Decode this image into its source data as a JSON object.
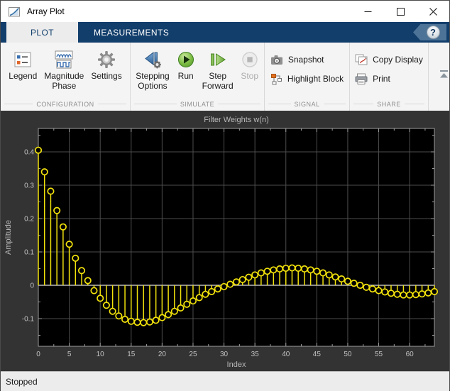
{
  "window": {
    "title": "Array Plot",
    "controls": {
      "minimize": "minimize",
      "maximize": "maximize",
      "close": "close"
    }
  },
  "tabs": {
    "plot": "PLOT",
    "measurements": "MEASUREMENTS",
    "help": "?"
  },
  "toolstrip": {
    "sections": {
      "configuration": {
        "label": "CONFIGURATION",
        "buttons": {
          "legend": {
            "lines": [
              "Legend"
            ]
          },
          "magnitude": {
            "lines": [
              "Magnitude",
              "Phase"
            ]
          },
          "settings": {
            "lines": [
              "Settings"
            ]
          }
        }
      },
      "simulate": {
        "label": "SIMULATE",
        "buttons": {
          "stepping": {
            "lines": [
              "Stepping",
              "Options"
            ]
          },
          "run": {
            "lines": [
              "Run"
            ]
          },
          "step": {
            "lines": [
              "Step",
              "Forward"
            ]
          },
          "stop": {
            "lines": [
              "Stop"
            ],
            "disabled": true
          }
        }
      },
      "signal": {
        "label": "SIGNAL",
        "buttons": {
          "snapshot": {
            "lines": [
              "Snapshot"
            ]
          },
          "highlight": {
            "lines": [
              "Highlight Block"
            ]
          }
        }
      },
      "share": {
        "label": "SHARE",
        "buttons": {
          "copy": {
            "lines": [
              "Copy Display"
            ]
          },
          "print": {
            "lines": [
              "Print"
            ]
          }
        }
      }
    }
  },
  "icons": {
    "app-icon": "mini line-plot window",
    "minimize-icon": "horizontal bar",
    "maximize-icon": "hollow square",
    "close-icon": "x cross",
    "help-icon": "question mark in glossy circle on left-arrow tag",
    "legend-icon": "list with blue and orange swatches",
    "magnitude-phase-icon": "sine waves over square wave",
    "settings-gear-icon": "gray gear",
    "stepping-options-icon": "blue step-back with small gear",
    "run-icon": "green circle with play triangle",
    "step-forward-icon": "green bar with forward triangle",
    "stop-icon": "gray circle with square (disabled)",
    "snapshot-camera-icon": "gray camera",
    "highlight-block-icon": "orange block diagram",
    "copy-display-icon": "pages with red trace",
    "print-icon": "printer",
    "collapse-toolstrip-icon": "up arrow with bar"
  },
  "status": {
    "text": "Stopped"
  },
  "chart_data": {
    "type": "stem",
    "title": "Filter Weights w(n)",
    "xlabel": "Index",
    "ylabel": "Amplitude",
    "x_start": 0,
    "x_step": 1,
    "values": [
      0.405,
      0.34,
      0.282,
      0.224,
      0.175,
      0.123,
      0.081,
      0.044,
      0.014,
      -0.016,
      -0.039,
      -0.06,
      -0.078,
      -0.092,
      -0.102,
      -0.108,
      -0.111,
      -0.112,
      -0.11,
      -0.105,
      -0.097,
      -0.088,
      -0.078,
      -0.068,
      -0.057,
      -0.047,
      -0.037,
      -0.027,
      -0.019,
      -0.011,
      -0.004,
      0.003,
      0.01,
      0.017,
      0.024,
      0.031,
      0.037,
      0.042,
      0.046,
      0.049,
      0.051,
      0.052,
      0.051,
      0.049,
      0.046,
      0.042,
      0.037,
      0.031,
      0.025,
      0.019,
      0.012,
      0.006,
      0.0,
      -0.006,
      -0.011,
      -0.016,
      -0.02,
      -0.024,
      -0.027,
      -0.029,
      -0.029,
      -0.028,
      -0.026,
      -0.023,
      -0.019
    ],
    "xlim": [
      0,
      64
    ],
    "ylim": [
      -0.183,
      0.47
    ],
    "xticks": [
      0,
      5,
      10,
      15,
      20,
      25,
      30,
      35,
      40,
      45,
      50,
      55,
      60
    ],
    "ytick_values": [
      -0.1,
      0,
      0.1,
      0.2,
      0.3,
      0.4
    ],
    "ytick_labels": [
      "-0.1",
      "0",
      "0.1",
      "0.2",
      "0.3",
      "0.4"
    ],
    "grid": true,
    "legend_position": "none",
    "colors": {
      "stem": "#f2e20c",
      "plot_bg": "#000000",
      "panel_bg": "#333333",
      "grid": "#4d4d4d",
      "axis_box": "#9d9d9d",
      "baseline": "#e0e0e0",
      "tick_label": "#c2c2c2",
      "title_label": "#b8b8b8"
    }
  }
}
